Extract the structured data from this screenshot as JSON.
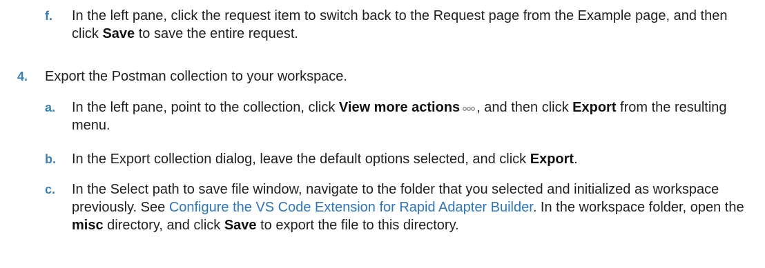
{
  "step_f": {
    "marker": "f.",
    "text_1": "In the left pane, click the request item to switch back to the Request page from the Example page, and then click ",
    "bold_1": "Save",
    "text_2": " to save the entire request."
  },
  "step_4": {
    "marker": "4.",
    "text": "Export the Postman collection to your workspace."
  },
  "step_a": {
    "marker": "a.",
    "text_1": "In the left pane, point to the collection, click ",
    "bold_1": "View more actions",
    "icon": "more-actions-icon",
    "text_2": ", and then click ",
    "bold_2": "Export",
    "text_3": " from the resulting menu."
  },
  "step_b": {
    "marker": "b.",
    "text_1": "In the Export collection dialog, leave the default options selected, and click ",
    "bold_1": "Export",
    "text_2": "."
  },
  "step_c": {
    "marker": "c.",
    "text_1": "In the Select path to save file window, navigate to the folder that you selected and initialized as workspace previously. See ",
    "link": "Configure the VS Code Extension for Rapid Adapter Builder",
    "text_2": ". In the workspace folder, open the ",
    "bold_1": "misc",
    "text_3": " directory, and click ",
    "bold_2": "Save",
    "text_4": " to export the file to this directory."
  },
  "colors": {
    "marker": "#3b7fb5",
    "link": "#2f74c0",
    "text": "#1f1f1f"
  }
}
